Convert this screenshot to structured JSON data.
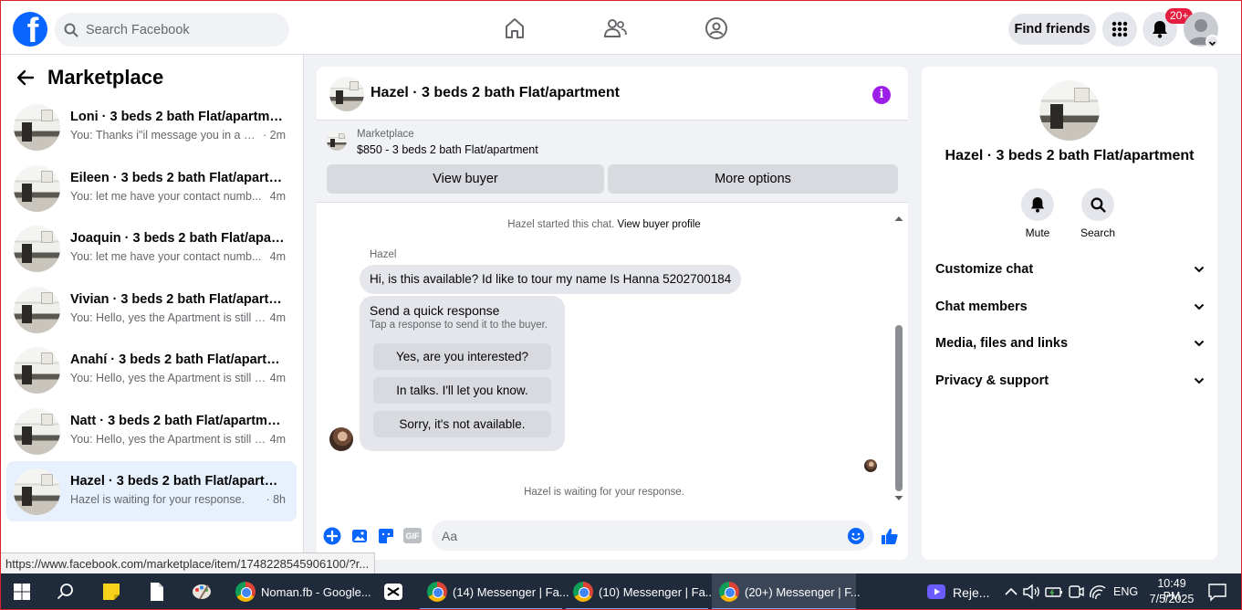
{
  "topbar": {
    "logo": "f",
    "search_placeholder": "Search Facebook",
    "find_friends": "Find friends",
    "notification_count": "20+",
    "nav_icons": [
      "home-icon",
      "friends-icon",
      "groups-icon"
    ]
  },
  "sidebar": {
    "title": "Marketplace",
    "conversations": [
      {
        "name": "Loni · 3 beds 2 bath Flat/apartment",
        "preview": "You: Thanks i\"il message you in a mo...",
        "time": "· 2m"
      },
      {
        "name": "Eileen · 3 beds 2 bath Flat/apartment",
        "preview": "You: let me have your contact numb...",
        "time": "4m"
      },
      {
        "name": "Joaquin · 3 beds 2 bath Flat/apartment",
        "preview": "You: let me have your contact numb...",
        "time": "4m"
      },
      {
        "name": "Vivian · 3 beds 2 bath Flat/apartment",
        "preview": "You: Hello, yes the Apartment is still a...",
        "time": "4m"
      },
      {
        "name": "Anahí · 3 beds 2 bath Flat/apartment",
        "preview": "You: Hello, yes the Apartment is still a...",
        "time": "4m"
      },
      {
        "name": "Natt · 3 beds 2 bath Flat/apartment",
        "preview": "You: Hello, yes the Apartment is still a...",
        "time": "4m"
      },
      {
        "name": "Hazel · 3 beds 2 bath Flat/apartment",
        "preview": "Hazel is waiting for your response.",
        "time": "· 8h"
      }
    ]
  },
  "chat": {
    "title": "Hazel · 3 beds 2 bath Flat/apartment",
    "marketplace_label": "Marketplace",
    "listing": "$850 - 3 beds 2 bath Flat/apartment",
    "view_buyer": "View buyer",
    "more_options": "More options",
    "started_text": "Hazel started this chat.",
    "view_buyer_profile": "View buyer profile",
    "sender": "Hazel",
    "message": "Hi, is this available? Id like to tour my name Is Hanna 5202700184",
    "quick_title": "Send a quick response",
    "quick_subtitle": "Tap a response to send it to the buyer.",
    "quick_responses": [
      "Yes, are you interested?",
      "In talks. I'll let you know.",
      "Sorry, it's not available."
    ],
    "waiting": "Hazel is waiting for your response.",
    "composer_placeholder": "Aa",
    "gif_label": "GIF"
  },
  "info": {
    "name": "Hazel · 3 beds 2 bath Flat/apartment",
    "mute": "Mute",
    "search": "Search",
    "sections": [
      "Customize chat",
      "Chat members",
      "Media, files and links",
      "Privacy & support"
    ]
  },
  "status_url": "https://www.facebook.com/marketplace/item/1748228545906100/?r...",
  "taskbar": {
    "apps": [
      {
        "label": "Noman.fb - Google...",
        "active": false
      },
      {
        "label": "(14) Messenger | Fa...",
        "active": false
      },
      {
        "label": "(10) Messenger | Fa...",
        "active": false
      },
      {
        "label": "(20+) Messenger | F...",
        "active": true
      }
    ],
    "tray_app": "Reje...",
    "language": "ENG",
    "time": "10:49 PM",
    "date": "7/5/2025"
  },
  "colors": {
    "brand": "#0866ff",
    "accent_purple": "#9b1fe8",
    "active_conversation": "#e7f0fd"
  }
}
